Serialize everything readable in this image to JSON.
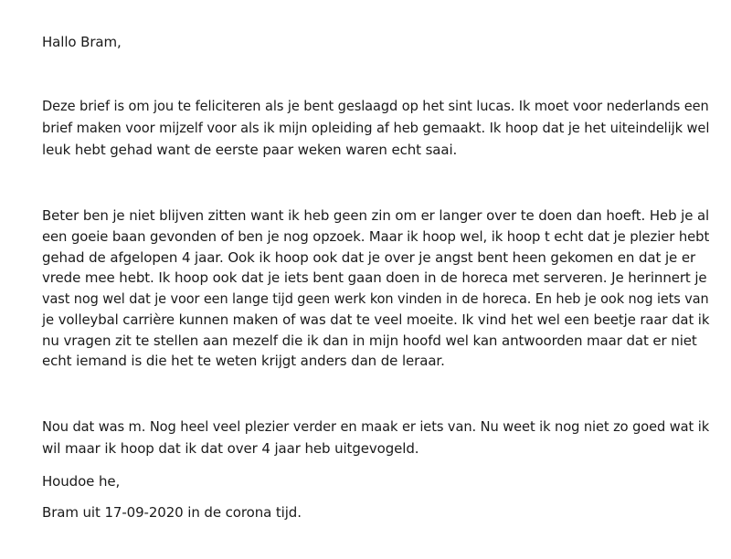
{
  "letter": {
    "greeting": "Hallo Bram,",
    "paragraph1": [
      "Deze brief is om jou te feliciteren als je bent geslaagd op het sint lucas. Ik moet voor nederlands een",
      "brief maken voor mijzelf voor als ik mijn opleiding af heb gemaakt. Ik hoop dat je het uiteindelijk wel",
      "leuk hebt gehad want de eerste paar weken waren echt saai."
    ],
    "paragraph2": [
      "Beter ben je niet blijven zitten want ik heb geen zin om er langer over te doen dan hoeft. Heb je al",
      "een goeie baan gevonden of ben je nog opzoek. Maar ik hoop wel, ik hoop t echt dat je plezier hebt",
      "gehad de afgelopen 4 jaar. Ook ik hoop ook dat je over je angst bent heen gekomen en dat je er",
      "vrede mee hebt. Ik hoop ook dat je iets bent gaan doen in de horeca met serveren. Je herinnert je",
      "vast nog wel dat je voor een lange tijd geen werk kon vinden in de horeca. En heb je ook nog iets van",
      "je volleybal carrière kunnen maken of was dat te veel moeite. Ik vind het wel een beetje raar dat ik",
      "nu vragen zit te stellen aan mezelf die ik dan in mijn hoofd wel kan antwoorden maar dat er niet",
      "echt iemand is die het te weten krijgt anders dan de leraar."
    ],
    "paragraph3": [
      "Nou dat was m. Nog heel veel plezier verder en maak er iets van. Nu weet ik nog niet zo goed wat ik",
      "wil maar ik hoop dat ik dat over 4 jaar heb uitgevogeld."
    ],
    "closing": "Houdoe he,",
    "signature": "Bram uit 17-09-2020 in de corona tijd."
  }
}
